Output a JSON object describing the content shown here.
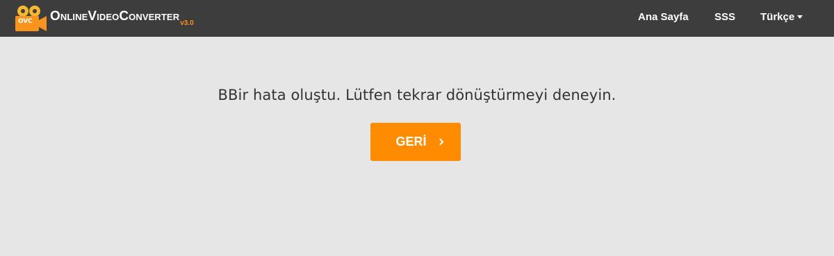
{
  "header": {
    "logo": {
      "badge": "OVC",
      "name": "OnlineVideoConverter",
      "version": "v3.0",
      "icon": "film-camera-icon",
      "accent_color": "#f7941d"
    },
    "nav": {
      "home_label": "Ana Sayfa",
      "faq_label": "SSS",
      "language_label": "Türkçe",
      "language_icon": "caret-down-icon"
    },
    "background_color": "#3d3d3d"
  },
  "main": {
    "message": "BBir hata oluştu. Lütfen tekrar dönüştürmeyi deneyin.",
    "back_button": {
      "label": "GERİ",
      "icon": "chevron-right-icon",
      "color": "#ff8c00"
    },
    "background_color": "#e6e6e6"
  }
}
